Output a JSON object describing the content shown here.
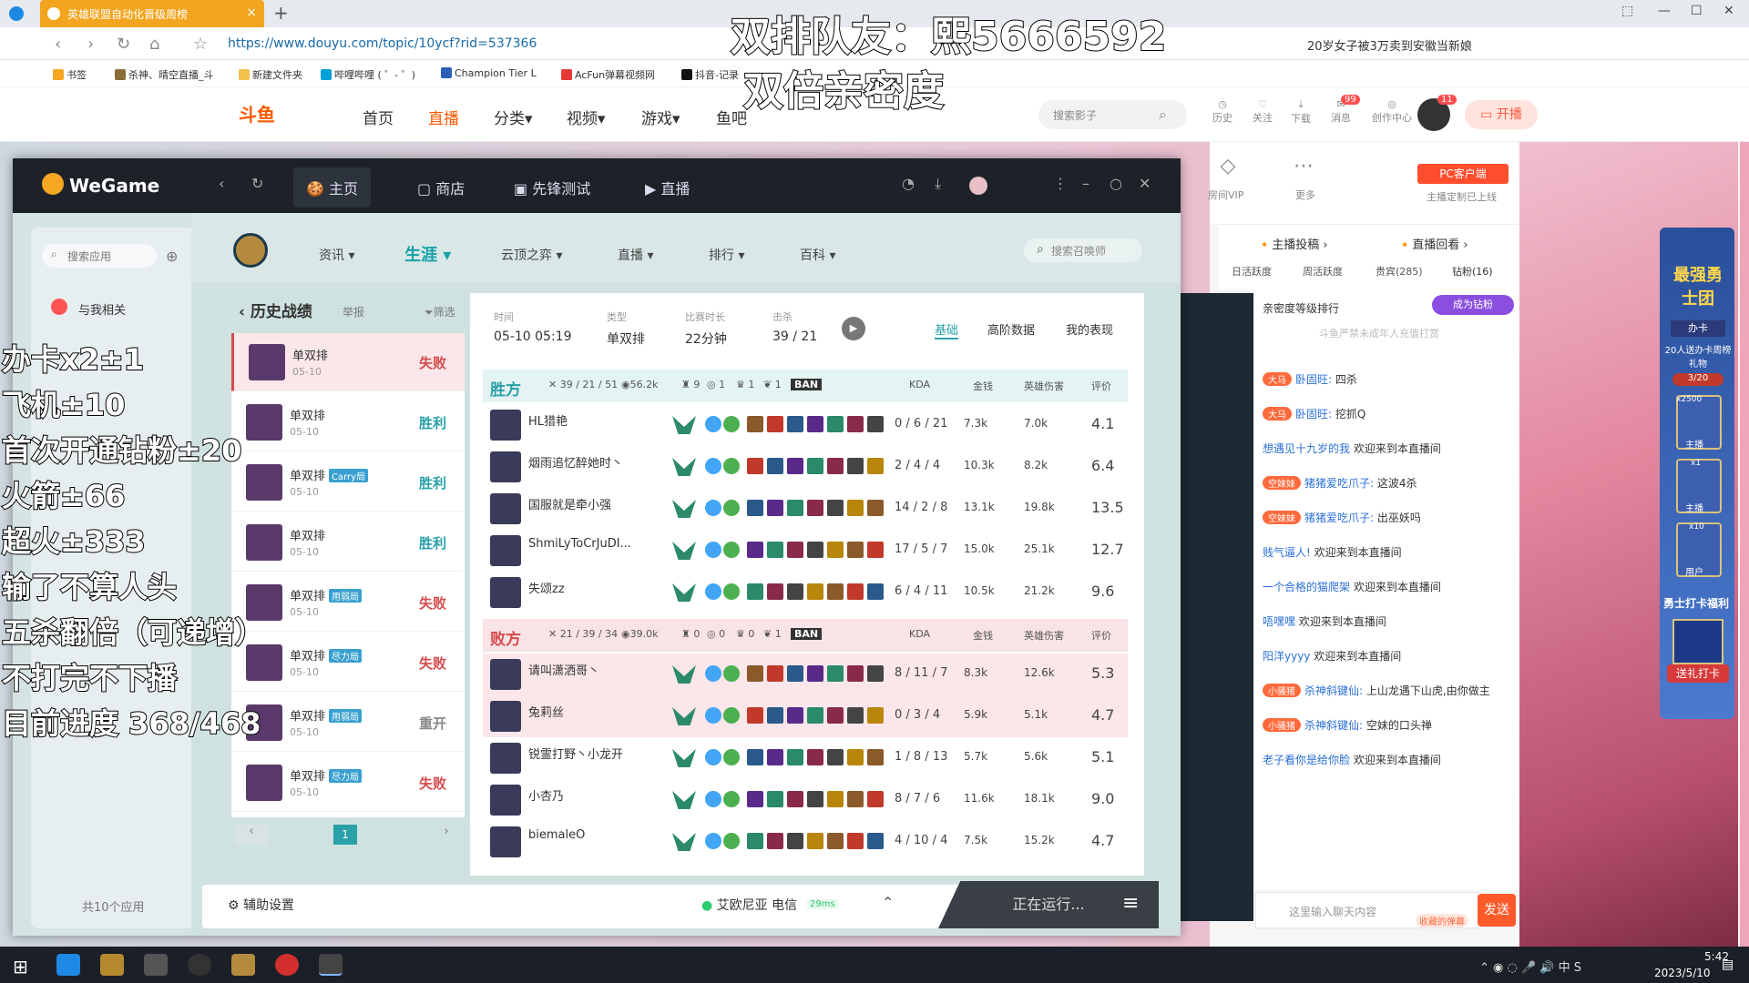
{
  "browser": {
    "tab_title": "英雄联盟自动化晋级周榜",
    "url": "https://www.douyu.com/topic/10ycf?rid=537366",
    "news": "20岁女子被3万卖到安徽当新娘",
    "bookmarks": [
      "书签",
      "杀神、晴空直播_斗",
      "新建文件夹",
      "哔哩哔哩 ( ゜- ゜)",
      "Champion Tier L",
      "AcFun弹幕视频网",
      "抖音-记录"
    ]
  },
  "douyu": {
    "logo": "斗鱼",
    "nav": [
      "首页",
      "直播",
      "分类▾",
      "视频▾",
      "游戏▾",
      "鱼吧"
    ],
    "search_placeholder": "搜索影子",
    "icons": [
      "历史",
      "关注",
      "下载",
      "消息",
      "创作中心"
    ],
    "msg_badge": "99",
    "avatar_badge": "11",
    "open_btn": "开播",
    "room_vip": "房间VIP",
    "more": "更多",
    "pc_client": "PC客户端",
    "pc_sub": "主播定制已上线",
    "tabs": [
      "主播投稿 ›",
      "直播回看 ›"
    ],
    "rank_tabs": [
      "日活跃度",
      "周活跃度",
      "贵宾(285)",
      "钻粉(16)"
    ],
    "intimacy": "亲密度等级排行",
    "become_fan": "成为钻粉",
    "minor_note": "斗鱼严禁未成年人充值打赏",
    "side_badge": "最强勇士团",
    "side_card": "办卡",
    "side_gift": "20人送办卡周榜礼物",
    "side_progress": "3/20",
    "side_count1": "x2500",
    "side_count2": "x1",
    "side_count3": "x10",
    "side_labels": [
      "主播",
      "主播",
      "用户"
    ],
    "warrior_card": "勇士打卡福利",
    "send_card": "送礼打卡",
    "chat_input_placeholder": "这里输入聊天内容",
    "collect": "收藏的弹幕",
    "send": "发送"
  },
  "chat": [
    {
      "badge": "大马",
      "user": "卧固旺:",
      "msg": "四杀"
    },
    {
      "badge": "大马",
      "user": "卧固旺:",
      "msg": "挖抓Q"
    },
    {
      "badge": "",
      "user": "想遇见十九岁的我",
      "msg": "欢迎来到本直播间"
    },
    {
      "badge": "空妹妹",
      "user": "猪猪爱吃爪子:",
      "msg": "这波4杀"
    },
    {
      "badge": "空妹妹",
      "user": "猪猪爱吃爪子:",
      "msg": "出巫妖吗"
    },
    {
      "badge": "",
      "user": "贱气逼人!",
      "msg": "欢迎来到本直播间"
    },
    {
      "badge": "",
      "user": "一个合格的猫爬架",
      "msg": "欢迎来到本直播间"
    },
    {
      "badge": "",
      "user": "唔嘿嘿",
      "msg": "欢迎来到本直播间"
    },
    {
      "badge": "",
      "user": "阳洋yyyy",
      "msg": "欢迎来到本直播间"
    },
    {
      "badge": "小骚猪",
      "user": "杀神斜键仙:",
      "msg": "上山龙遇下山虎,由你做主"
    },
    {
      "badge": "小骚猪",
      "user": "杀神斜键仙:",
      "msg": "空妹的口头禅"
    },
    {
      "badge": "",
      "user": "老子看你是给你脸",
      "msg": "欢迎来到本直播间"
    }
  ],
  "wegame": {
    "logo": "WeGame",
    "nav": [
      "主页",
      "商店",
      "先锋测试",
      "直播"
    ],
    "app_search": "搜索应用",
    "related": "与我相关",
    "app_count": "共10个应用",
    "assist": "辅助设置",
    "server": "艾欧尼亚 电信",
    "ping": "29ms",
    "running": "正在运行..."
  },
  "lol": {
    "nav": [
      "资讯",
      "生涯",
      "云顶之弈",
      "直播",
      "排行",
      "百科"
    ],
    "summoner_search": "搜索召唤师",
    "history_title": "历史战绩",
    "report": "举报",
    "filter": "筛选",
    "history": [
      {
        "mode": "单双排",
        "date": "05-10",
        "result": "失败",
        "tag": ""
      },
      {
        "mode": "单双排",
        "date": "05-10",
        "result": "胜利",
        "tag": ""
      },
      {
        "mode": "单双排",
        "date": "05-10",
        "result": "胜利",
        "tag": "Carry局"
      },
      {
        "mode": "单双排",
        "date": "05-10",
        "result": "胜利",
        "tag": ""
      },
      {
        "mode": "单双排",
        "date": "05-10",
        "result": "失败",
        "tag": "用弱局"
      },
      {
        "mode": "单双排",
        "date": "05-10",
        "result": "失败",
        "tag": "尽力局"
      },
      {
        "mode": "单双排",
        "date": "05-10",
        "result": "重开",
        "tag": "用弱局"
      },
      {
        "mode": "单双排",
        "date": "05-10",
        "result": "失败",
        "tag": "尽力局"
      }
    ],
    "page": "1",
    "match": {
      "time_label": "时间",
      "time": "05-10 05:19",
      "type_label": "类型",
      "type": "单双排",
      "dur_label": "比赛时长",
      "dur": "22分钟",
      "kill_label": "击杀",
      "kill": "39 / 21",
      "tabs": [
        "基础",
        "高阶数据",
        "我的表现"
      ]
    },
    "col_headers": [
      "KDA",
      "金钱",
      "英雄伤害",
      "评价"
    ],
    "ban": "BAN",
    "win_team": {
      "name": "胜方",
      "kda": "39 / 21 / 51",
      "gold": "56.2k",
      "towers": "9",
      "inhib": "1",
      "baron": "1",
      "dragon": "1",
      "players": [
        {
          "name": "HL猎艳",
          "kda": "0 / 6 / 21",
          "gold": "7.3k",
          "dmg": "7.0k",
          "rate": "4.1"
        },
        {
          "name": "烟雨追忆醉她时丶",
          "kda": "2 / 4 / 4",
          "gold": "10.3k",
          "dmg": "8.2k",
          "rate": "6.4"
        },
        {
          "name": "国服就是牵小强",
          "kda": "14 / 2 / 8",
          "gold": "13.1k",
          "dmg": "19.8k",
          "rate": "13.5"
        },
        {
          "name": "ShmiLyToCrJuDI...",
          "kda": "17 / 5 / 7",
          "gold": "15.0k",
          "dmg": "25.1k",
          "rate": "12.7"
        },
        {
          "name": "失颂zz",
          "kda": "6 / 4 / 11",
          "gold": "10.5k",
          "dmg": "21.2k",
          "rate": "9.6"
        }
      ]
    },
    "lose_team": {
      "name": "败方",
      "kda": "21 / 39 / 34",
      "gold": "39.0k",
      "towers": "0",
      "inhib": "0",
      "baron": "0",
      "dragon": "1",
      "players": [
        {
          "name": "请叫潇洒哥丶",
          "kda": "8 / 11 / 7",
          "gold": "8.3k",
          "dmg": "12.6k",
          "rate": "5.3"
        },
        {
          "name": "兔莉丝",
          "kda": "0 / 3 / 4",
          "gold": "5.9k",
          "dmg": "5.1k",
          "rate": "4.7"
        },
        {
          "name": "锐霊打野丶小龙开",
          "kda": "1 / 8 / 13",
          "gold": "5.7k",
          "dmg": "5.6k",
          "rate": "5.1"
        },
        {
          "name": "小杏乃",
          "kda": "8 / 7 / 6",
          "gold": "11.6k",
          "dmg": "18.1k",
          "rate": "9.0"
        },
        {
          "name": "biemaleO",
          "kda": "4 / 10 / 4",
          "gold": "7.5k",
          "dmg": "15.2k",
          "rate": "4.7"
        }
      ]
    }
  },
  "overlay": {
    "top1": "双排队友：熙5666592",
    "top2": "双倍亲密度",
    "lines": [
      "办卡x2±1",
      "飞机±10",
      "首次开通钻粉±20",
      "火箭±66",
      "超火±333",
      "输了不算人头",
      "五杀翻倍（可递增）",
      "不打完不下播",
      "目前进度 368/468"
    ]
  },
  "taskbar": {
    "time": "5:42",
    "date": "2023/5/10",
    "ime": "中"
  },
  "colors": {
    "win": "#2aa1a9",
    "lose": "#d64b4b",
    "douyu": "#ff5a00",
    "wegame_dark": "#1d2229"
  }
}
